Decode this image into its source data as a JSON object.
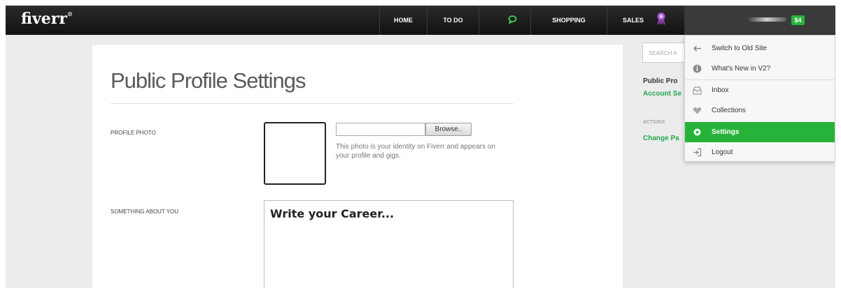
{
  "header": {
    "logo": "fiverr",
    "logo_mark": "®",
    "nav": {
      "home": "HOME",
      "todo": "TO DO",
      "shopping": "SHOPPING",
      "sales": "SALES"
    },
    "balance": "$4"
  },
  "main": {
    "title": "Public Profile Settings",
    "photo_label": "PROFILE PHOTO",
    "browse_label": "Browse..",
    "photo_help": "This photo is your identity on Fiverr and appears on your profile and gigs.",
    "about_label": "SOMETHING ABOUT YOU",
    "about_value": "Write your Career..."
  },
  "sidebar": {
    "search_placeholder": "SEARCH A",
    "public_profile": "Public Pro",
    "account_settings": "Account Se",
    "actions": "ACTIONS",
    "change_password": "Change Pa"
  },
  "dropdown": {
    "items": [
      {
        "label": "Switch to Old Site",
        "icon": "arrow-left-icon"
      },
      {
        "label": "What's New in V2?",
        "icon": "info-icon"
      },
      {
        "label": "Inbox",
        "icon": "inbox-icon"
      },
      {
        "label": "Collections",
        "icon": "heart-icon"
      },
      {
        "label": "Settings",
        "icon": "gear-icon",
        "active": true
      },
      {
        "label": "Logout",
        "icon": "logout-icon"
      }
    ]
  },
  "colors": {
    "accent": "#27b33a",
    "topbar": "#1a1a1a",
    "sales_badge": "#8e44ad"
  }
}
